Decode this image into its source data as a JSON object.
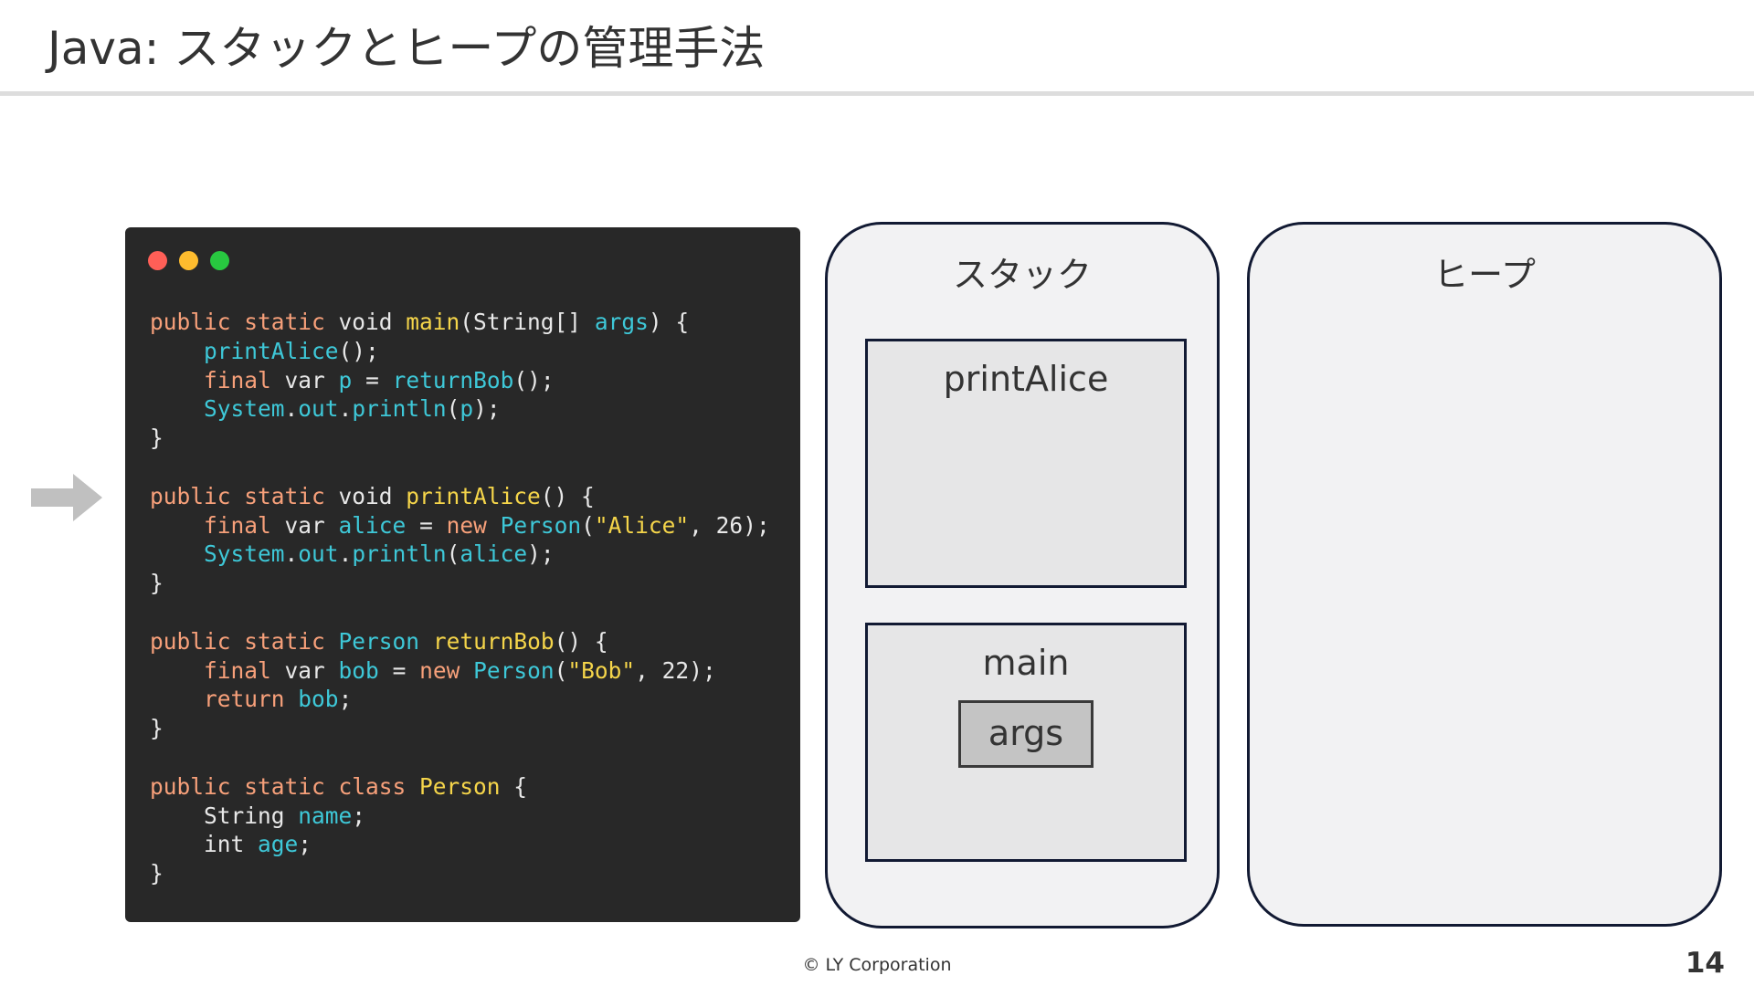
{
  "slide": {
    "title": "Java: スタックとヒープの管理手法",
    "footer": "© LY Corporation",
    "page_number": "14"
  },
  "code_window": {
    "window_buttons": [
      "close",
      "minimize",
      "maximize"
    ],
    "colors": {
      "background": "#282828",
      "keyword": "#f7a07a",
      "function": "#f5d54a",
      "identifier": "#3ec8d8",
      "string": "#f5d54a",
      "plain": "#e8e8e8"
    },
    "lines": [
      [
        {
          "t": "kw",
          "s": "public static"
        },
        {
          "t": "plain",
          "s": " void "
        },
        {
          "t": "fn",
          "s": "main"
        },
        {
          "t": "plain",
          "s": "(String[] "
        },
        {
          "t": "id",
          "s": "args"
        },
        {
          "t": "plain",
          "s": ") {"
        }
      ],
      [
        {
          "t": "plain",
          "s": "    "
        },
        {
          "t": "id",
          "s": "printAlice"
        },
        {
          "t": "plain",
          "s": "();"
        }
      ],
      [
        {
          "t": "plain",
          "s": "    "
        },
        {
          "t": "kw",
          "s": "final"
        },
        {
          "t": "plain",
          "s": " var "
        },
        {
          "t": "id",
          "s": "p"
        },
        {
          "t": "plain",
          "s": " = "
        },
        {
          "t": "id",
          "s": "returnBob"
        },
        {
          "t": "plain",
          "s": "();"
        }
      ],
      [
        {
          "t": "plain",
          "s": "    "
        },
        {
          "t": "id",
          "s": "System"
        },
        {
          "t": "plain",
          "s": "."
        },
        {
          "t": "id",
          "s": "out"
        },
        {
          "t": "plain",
          "s": "."
        },
        {
          "t": "id",
          "s": "println"
        },
        {
          "t": "plain",
          "s": "("
        },
        {
          "t": "id",
          "s": "p"
        },
        {
          "t": "plain",
          "s": ");"
        }
      ],
      [
        {
          "t": "plain",
          "s": "}"
        }
      ],
      [],
      [
        {
          "t": "kw",
          "s": "public static"
        },
        {
          "t": "plain",
          "s": " void "
        },
        {
          "t": "fn",
          "s": "printAlice"
        },
        {
          "t": "plain",
          "s": "() {"
        }
      ],
      [
        {
          "t": "plain",
          "s": "    "
        },
        {
          "t": "kw",
          "s": "final"
        },
        {
          "t": "plain",
          "s": " var "
        },
        {
          "t": "id",
          "s": "alice"
        },
        {
          "t": "plain",
          "s": " = "
        },
        {
          "t": "kw",
          "s": "new"
        },
        {
          "t": "plain",
          "s": " "
        },
        {
          "t": "id",
          "s": "Person"
        },
        {
          "t": "plain",
          "s": "("
        },
        {
          "t": "str",
          "s": "\"Alice\""
        },
        {
          "t": "plain",
          "s": ", "
        },
        {
          "t": "num",
          "s": "26"
        },
        {
          "t": "plain",
          "s": ");"
        }
      ],
      [
        {
          "t": "plain",
          "s": "    "
        },
        {
          "t": "id",
          "s": "System"
        },
        {
          "t": "plain",
          "s": "."
        },
        {
          "t": "id",
          "s": "out"
        },
        {
          "t": "plain",
          "s": "."
        },
        {
          "t": "id",
          "s": "println"
        },
        {
          "t": "plain",
          "s": "("
        },
        {
          "t": "id",
          "s": "alice"
        },
        {
          "t": "plain",
          "s": ");"
        }
      ],
      [
        {
          "t": "plain",
          "s": "}"
        }
      ],
      [],
      [
        {
          "t": "kw",
          "s": "public static"
        },
        {
          "t": "plain",
          "s": " "
        },
        {
          "t": "id",
          "s": "Person"
        },
        {
          "t": "plain",
          "s": " "
        },
        {
          "t": "fn",
          "s": "returnBob"
        },
        {
          "t": "plain",
          "s": "() {"
        }
      ],
      [
        {
          "t": "plain",
          "s": "    "
        },
        {
          "t": "kw",
          "s": "final"
        },
        {
          "t": "plain",
          "s": " var "
        },
        {
          "t": "id",
          "s": "bob"
        },
        {
          "t": "plain",
          "s": " = "
        },
        {
          "t": "kw",
          "s": "new"
        },
        {
          "t": "plain",
          "s": " "
        },
        {
          "t": "id",
          "s": "Person"
        },
        {
          "t": "plain",
          "s": "("
        },
        {
          "t": "str",
          "s": "\"Bob\""
        },
        {
          "t": "plain",
          "s": ", "
        },
        {
          "t": "num",
          "s": "22"
        },
        {
          "t": "plain",
          "s": ");"
        }
      ],
      [
        {
          "t": "plain",
          "s": "    "
        },
        {
          "t": "kw",
          "s": "return"
        },
        {
          "t": "plain",
          "s": " "
        },
        {
          "t": "id",
          "s": "bob"
        },
        {
          "t": "plain",
          "s": ";"
        }
      ],
      [
        {
          "t": "plain",
          "s": "}"
        }
      ],
      [],
      [
        {
          "t": "kw",
          "s": "public static class"
        },
        {
          "t": "plain",
          "s": " "
        },
        {
          "t": "fn",
          "s": "Person"
        },
        {
          "t": "plain",
          "s": " {"
        }
      ],
      [
        {
          "t": "plain",
          "s": "    String "
        },
        {
          "t": "id",
          "s": "name"
        },
        {
          "t": "plain",
          "s": ";"
        }
      ],
      [
        {
          "t": "plain",
          "s": "    int "
        },
        {
          "t": "id",
          "s": "age"
        },
        {
          "t": "plain",
          "s": ";"
        }
      ],
      [
        {
          "t": "plain",
          "s": "}"
        }
      ]
    ]
  },
  "current_line_arrow": {
    "icon": "right-arrow-icon",
    "color": "#c0c0c0",
    "points_to_line": 7
  },
  "stack": {
    "title": "スタック",
    "frames": [
      {
        "label": "printAlice",
        "variables": []
      },
      {
        "label": "main",
        "variables": [
          "args"
        ]
      }
    ]
  },
  "heap": {
    "title": "ヒープ",
    "objects": []
  }
}
